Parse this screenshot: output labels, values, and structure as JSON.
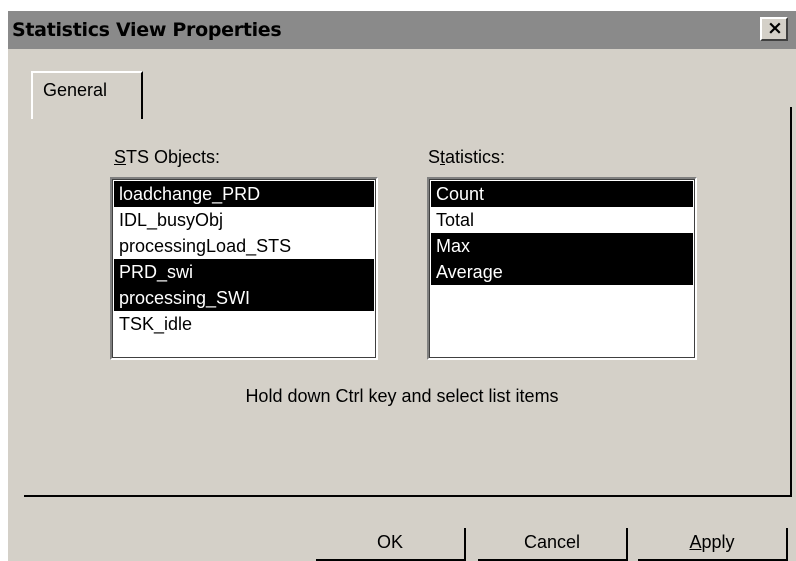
{
  "window": {
    "title": "Statistics View Properties",
    "close_label": "×"
  },
  "tabs": [
    {
      "label": "General",
      "active": true
    }
  ],
  "sts_objects": {
    "label_accel": "S",
    "label_rest": "TS Objects:",
    "items": [
      {
        "label": "loadchange_PRD",
        "selected": true
      },
      {
        "label": "IDL_busyObj",
        "selected": false
      },
      {
        "label": "processingLoad_STS",
        "selected": false
      },
      {
        "label": "PRD_swi",
        "selected": true
      },
      {
        "label": "processing_SWI",
        "selected": true
      },
      {
        "label": "TSK_idle",
        "selected": false
      }
    ]
  },
  "statistics": {
    "label_pre": "S",
    "label_accel": "t",
    "label_rest": "atistics:",
    "items": [
      {
        "label": "Count",
        "selected": true
      },
      {
        "label": "Total",
        "selected": false
      },
      {
        "label": "Max",
        "selected": true
      },
      {
        "label": "Average",
        "selected": true
      }
    ]
  },
  "hint": "Hold down Ctrl key and select list items",
  "buttons": {
    "ok": "OK",
    "cancel": "Cancel",
    "apply_accel": "A",
    "apply_rest": "pply"
  },
  "colors": {
    "face": "#d4d0c8",
    "titlebar": "#8a8a8a",
    "selection_bg": "#000000",
    "selection_fg": "#ffffff"
  }
}
